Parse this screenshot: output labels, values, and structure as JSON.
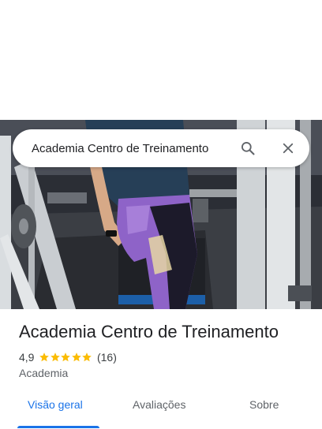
{
  "search": {
    "query": "Academia Centro de Treinamento",
    "search_icon": "search-icon",
    "close_icon": "close-icon"
  },
  "photo": {
    "description_icon": "place-photo"
  },
  "place": {
    "title": "Academia Centro de Treinamento",
    "rating": "4,9",
    "stars": 5,
    "review_count": "(16)",
    "category": "Academia"
  },
  "tabs": [
    {
      "label": "Visão geral",
      "active": true
    },
    {
      "label": "Avaliações",
      "active": false
    },
    {
      "label": "Sobre",
      "active": false
    }
  ],
  "colors": {
    "accent": "#1a73e8",
    "star": "#fbbc04",
    "title": "#202124",
    "secondary": "#5f6368"
  }
}
